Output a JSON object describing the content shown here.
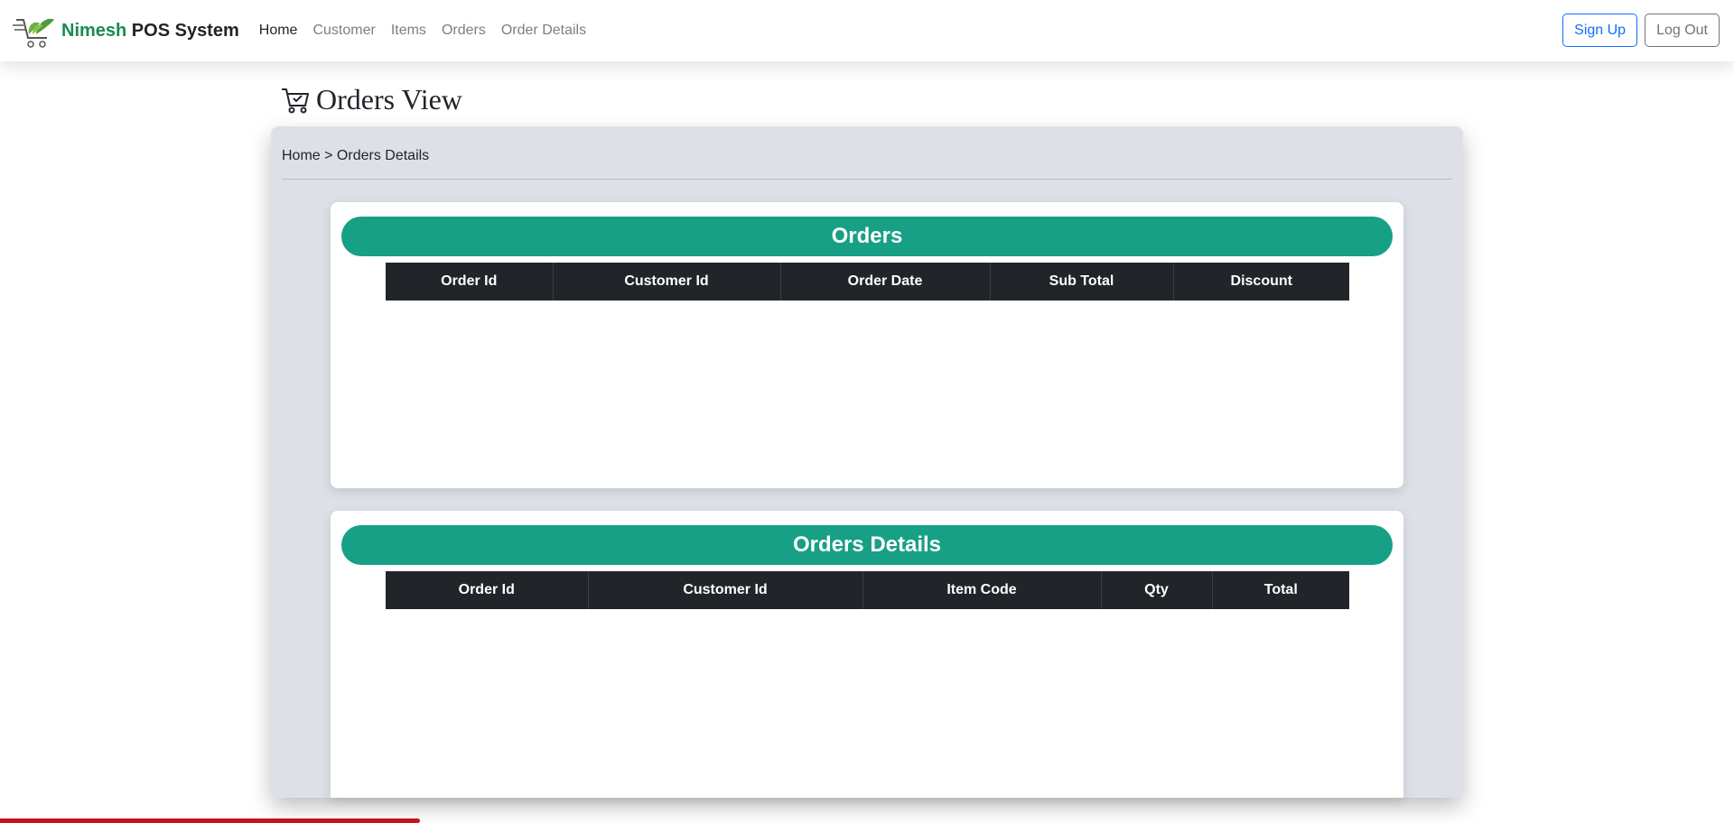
{
  "navbar": {
    "brand_accent": "Nimesh",
    "brand_rest": " POS System",
    "links": [
      "Home",
      "Customer",
      "Items",
      "Orders",
      "Order Details"
    ],
    "signup_label": "Sign Up",
    "logout_label": "Log Out"
  },
  "page": {
    "title": "Orders View",
    "breadcrumb_home": "Home",
    "breadcrumb_sep": " > ",
    "breadcrumb_current": "Orders Details"
  },
  "orders": {
    "header": "Orders",
    "columns": [
      "Order Id",
      "Customer Id",
      "Order Date",
      "Sub Total",
      "Discount"
    ],
    "rows": []
  },
  "order_details": {
    "header": "Orders Details",
    "columns": [
      "Order Id",
      "Customer Id",
      "Item Code",
      "Qty",
      "Total"
    ],
    "rows": []
  },
  "colors": {
    "accent_green": "#17a085",
    "brand_green": "#1a8a50",
    "table_header": "#212529",
    "panel_bg": "#dde1e7",
    "progress_red": "#c8101e"
  }
}
